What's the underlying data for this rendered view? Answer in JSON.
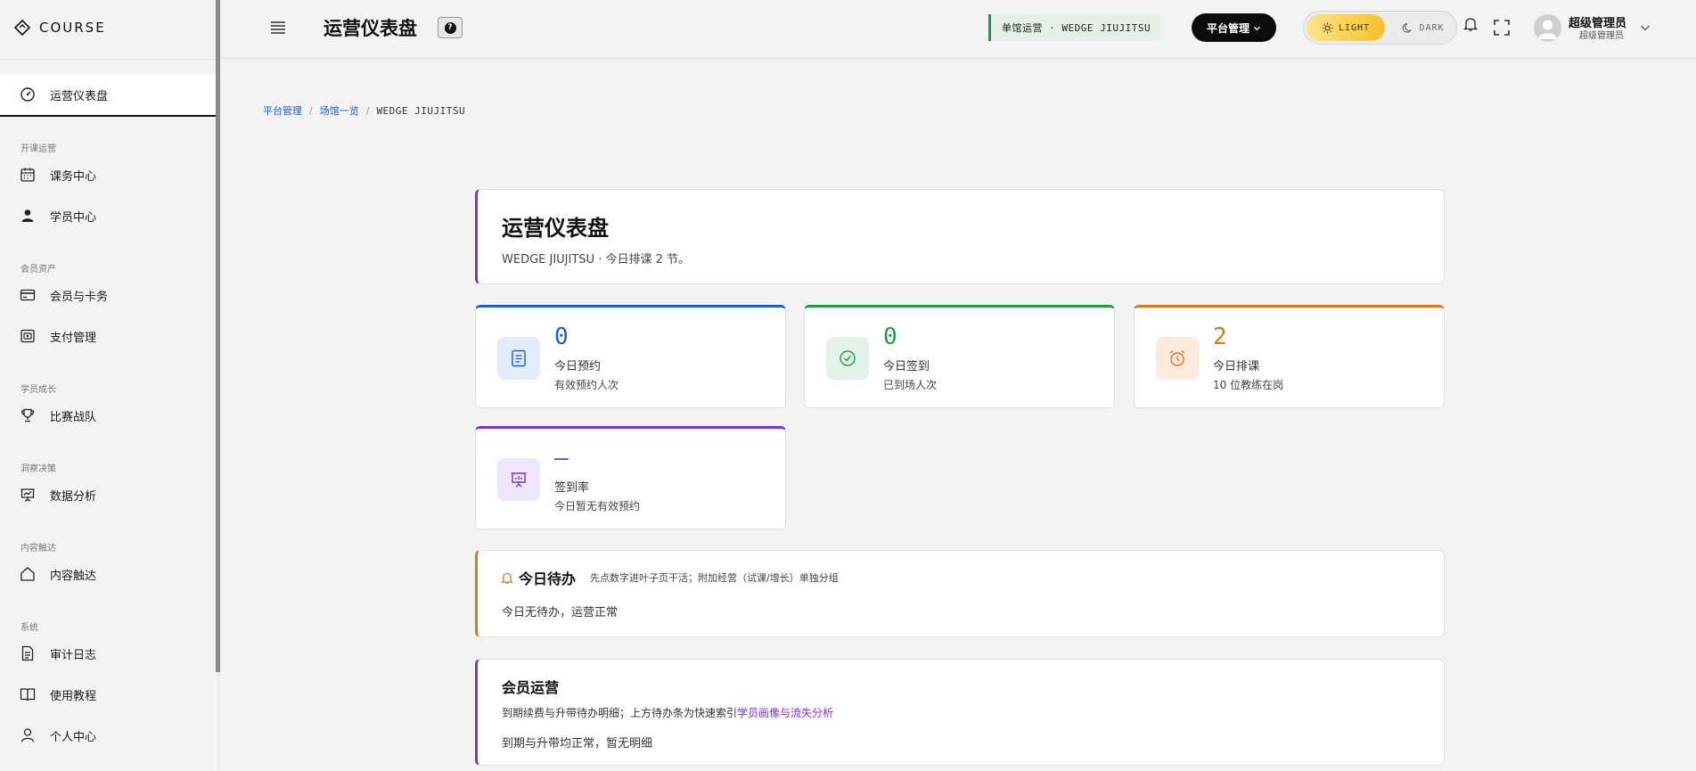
{
  "brand": {
    "name": "COURSE"
  },
  "sidebar": {
    "active": {
      "label": "运营仪表盘",
      "icon": "dashboard-gauge-icon"
    },
    "groups": [
      {
        "label": "开课运营"
      },
      {
        "label": "会员资产"
      },
      {
        "label": "学员成长"
      },
      {
        "label": "洞察决策"
      },
      {
        "label": "内容触达"
      },
      {
        "label": "系统"
      }
    ],
    "items": [
      {
        "label": "课务中心",
        "icon": "calendar-icon"
      },
      {
        "label": "学员中心",
        "icon": "user-icon"
      },
      {
        "label": "会员与卡务",
        "icon": "credit-card-icon"
      },
      {
        "label": "支付管理",
        "icon": "payment-icon"
      },
      {
        "label": "比赛战队",
        "icon": "trophy-icon"
      },
      {
        "label": "数据分析",
        "icon": "presentation-chart-icon"
      },
      {
        "label": "内容触达",
        "icon": "home-icon"
      },
      {
        "label": "审计日志",
        "icon": "document-icon"
      },
      {
        "label": "使用教程",
        "icon": "book-icon"
      },
      {
        "label": "个人中心",
        "icon": "user-outline-icon"
      }
    ]
  },
  "header": {
    "title": "运营仪表盘",
    "help": "?",
    "scope": "单馆运营 · WEDGE JIUJITSU",
    "platform_button": "平台管理",
    "theme": {
      "light": "LIGHT",
      "dark": "DARK",
      "selected": "LIGHT"
    },
    "user": {
      "name": "超级管理员",
      "role": "超级管理员"
    }
  },
  "breadcrumb": {
    "items": [
      "平台管理",
      "场馆一览"
    ],
    "current": "WEDGE JIUJITSU",
    "separator": "/"
  },
  "hero": {
    "title": "运营仪表盘",
    "subtitle": "WEDGE JIUJITSU · 今日排课 2 节。"
  },
  "stats": [
    {
      "value": "0",
      "label": "今日预约",
      "desc": "有效预约人次",
      "color": "#1a5fd1",
      "bg": "#e3ecfb",
      "icon": "list-document-icon"
    },
    {
      "value": "0",
      "label": "今日签到",
      "desc": "已到场人次",
      "color": "#1f9a45",
      "bg": "#e3f3e8",
      "icon": "check-circle-icon"
    },
    {
      "value": "2",
      "label": "今日排课",
      "desc": "10 位教练在岗",
      "color": "#e07418",
      "bg": "#fcebdc",
      "icon": "alarm-clock-icon"
    },
    {
      "value": "—",
      "label": "签到率",
      "desc": "今日暂无有效预约",
      "color": "#7a35d8",
      "bg": "#efe6fb",
      "icon": "presentation-board-icon"
    }
  ],
  "todo": {
    "title": "今日待办",
    "hint": "先点数字进叶子页干活；附加经营（试课/增长）单独分组",
    "body": "今日无待办，运营正常",
    "accent": "#e07418"
  },
  "member_ops": {
    "title": "会员运营",
    "desc_prefix": "到期续费与升带待办明细；上方待办条为快速索引",
    "desc_link": "学员画像与流失分析",
    "body": "到期与升带均正常，暂无明细"
  }
}
